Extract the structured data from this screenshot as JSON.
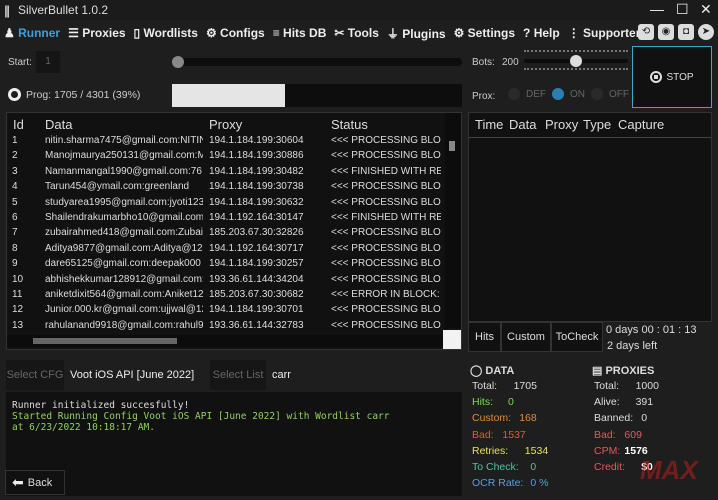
{
  "window": {
    "title": "SilverBullet 1.0.2",
    "minimize": "—",
    "maximize": "☐",
    "close": "✕"
  },
  "nav": [
    {
      "label": "Runner",
      "icon": "runner-icon"
    },
    {
      "label": "Proxies",
      "icon": "proxies-icon"
    },
    {
      "label": "Wordlists",
      "icon": "wordlists-icon"
    },
    {
      "label": "Configs",
      "icon": "gear-icon"
    },
    {
      "label": "Hits DB",
      "icon": "database-icon"
    },
    {
      "label": "Tools",
      "icon": "tools-icon"
    },
    {
      "label": "Plugins",
      "icon": "plug-icon"
    },
    {
      "label": "Settings",
      "icon": "gear-icon"
    },
    {
      "label": "Help",
      "icon": "help-icon"
    },
    {
      "label": "Supporters",
      "icon": "dots-icon"
    }
  ],
  "runner": {
    "start_label": "Start:",
    "start_value": "1",
    "bots_label": "Bots:",
    "bots_value": "200",
    "bots_fraction": 0.5,
    "progress_text": "Prog: 1705 / 4301 (39%)",
    "progress_fraction": 0.39,
    "prox_label": "Prox:",
    "prox_options": [
      "DEF",
      "ON",
      "OFF"
    ],
    "prox_selected": "ON",
    "stop_label": "STOP"
  },
  "grid": {
    "headers": [
      "Id",
      "Data",
      "Proxy",
      "Status"
    ],
    "rows": [
      [
        "1",
        "nitin.sharma7475@gmail.com:NITIN",
        "194.1.184.199:30604",
        "<<< PROCESSING BLOCK"
      ],
      [
        "2",
        "Manojmaurya250131@gmail.com:M",
        "194.1.184.199:30886",
        "<<< PROCESSING BLOCK"
      ],
      [
        "3",
        "Namanmangal1990@gmail.com:76",
        "194.1.184.199:30482",
        "<<< FINISHED WITH RES"
      ],
      [
        "4",
        "Tarun454@ymail.com:greenland",
        "194.1.184.199:30738",
        "<<< PROCESSING BLOCK"
      ],
      [
        "5",
        "studyarea1995@gmail.com:jyoti123",
        "194.1.184.199:30632",
        "<<< PROCESSING BLOCK"
      ],
      [
        "6",
        "Shailendrakumarbho10@gmail.com",
        "194.1.192.164:30147",
        "<<< FINISHED WITH RES"
      ],
      [
        "7",
        "zubairahmed418@gmail.com:Zubai",
        "185.203.67.30:32826",
        "<<< PROCESSING BLOCK"
      ],
      [
        "8",
        "Aditya9877@gmail.com:Aditya@12",
        "194.1.192.164:30717",
        "<<< PROCESSING BLOCK"
      ],
      [
        "9",
        "dare65125@gmail.com:deepak000",
        "194.1.184.199:30257",
        "<<< PROCESSING BLOCK"
      ],
      [
        "10",
        "abhishekkumar128912@gmail.com:",
        "193.36.61.144:34204",
        "<<< PROCESSING BLOCK"
      ],
      [
        "11",
        "aniketdixit564@gmail.com:Aniket12",
        "185.203.67.30:30682",
        "<<< ERROR IN BLOCK: R"
      ],
      [
        "12",
        "Junior.000.kr@gmail.com:ujjwal@12",
        "194.1.184.199:30701",
        "<<< PROCESSING BLOCK"
      ],
      [
        "13",
        "rahulanand9918@gmail.com:rahul9",
        "193.36.61.144:32783",
        "<<< PROCESSING BLOCK"
      ]
    ]
  },
  "hits_grid": {
    "headers": [
      "Time",
      "Data",
      "Proxy",
      "Type",
      "Capture"
    ]
  },
  "tabs": [
    "Hits",
    "Custom",
    "ToCheck"
  ],
  "timer": {
    "elapsed": "0  days  00 : 01 : 13",
    "left": "2 days left"
  },
  "config": {
    "select_cfg": "Select CFG",
    "cfg_value": "Voot iOS API [June 2022]",
    "select_list": "Select List",
    "list_value": "carr"
  },
  "log": {
    "line1": "Runner initialized succesfully!",
    "line2": "Started Running Config Voot iOS API [June 2022] with Wordlist carr at 6/23/2022 10:18:17 AM."
  },
  "back_label": "Back",
  "data_stats": {
    "title": "DATA",
    "items": [
      {
        "label": "Total:",
        "value": "1705",
        "color": "#dddddd"
      },
      {
        "label": "Hits:",
        "value": "0",
        "color": "#7ed957"
      },
      {
        "label": "Custom:",
        "value": "168",
        "color": "#e08a3c"
      },
      {
        "label": "Bad:",
        "value": "1537",
        "color": "#e05a3c"
      },
      {
        "label": "Retries:",
        "value": "1534",
        "color": "#e8e05a"
      },
      {
        "label": "To Check:",
        "value": "0",
        "color": "#4fc3a0"
      },
      {
        "label": "OCR Rate:",
        "value": "0 %",
        "color": "#5a9ee0"
      }
    ]
  },
  "proxy_stats": {
    "title": "PROXIES",
    "items": [
      {
        "label": "Total:",
        "value": "1000",
        "color": "#dddddd"
      },
      {
        "label": "Alive:",
        "value": "391",
        "color": "#dddddd"
      },
      {
        "label": "Banned:",
        "value": "0",
        "color": "#dddddd"
      },
      {
        "label": "Bad:",
        "value": "609",
        "color": "#e05a5a"
      },
      {
        "label": "CPM:",
        "value": "1576",
        "color": "#e05a5a"
      },
      {
        "label": "Credit:",
        "value": "$0",
        "color": "#e05a5a"
      }
    ]
  },
  "watermark": "MAX"
}
